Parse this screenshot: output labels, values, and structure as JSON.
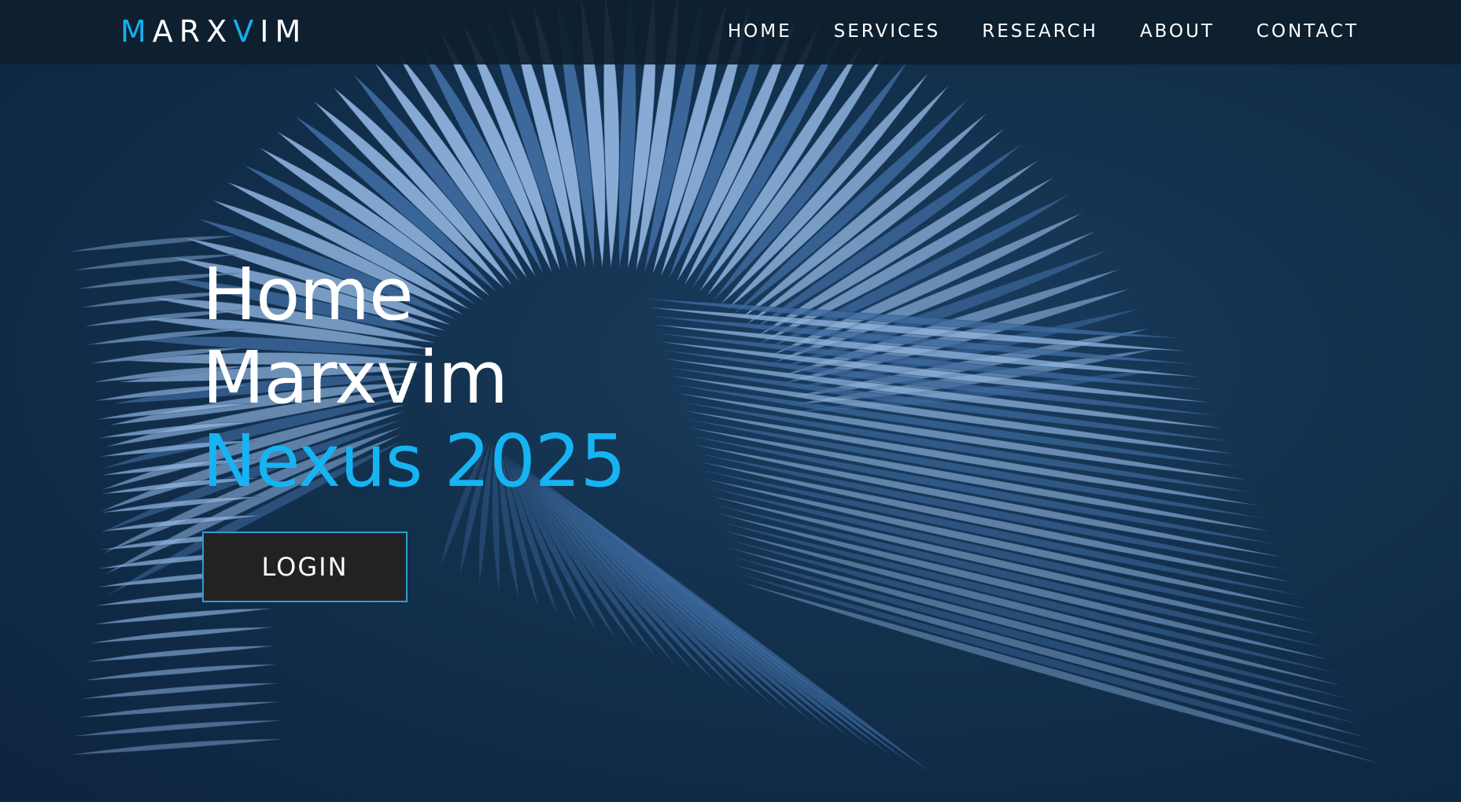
{
  "brand": {
    "logo_parts": [
      {
        "text": "M",
        "accent": true
      },
      {
        "text": "ARX",
        "accent": false
      },
      {
        "text": "V",
        "accent": true
      },
      {
        "text": "IM",
        "accent": false
      }
    ]
  },
  "nav": {
    "items": [
      {
        "label": "HOME"
      },
      {
        "label": "SERVICES"
      },
      {
        "label": "RESEARCH"
      },
      {
        "label": "ABOUT"
      },
      {
        "label": "CONTACT"
      }
    ]
  },
  "hero": {
    "line1": "Home",
    "line2": "Marxvim",
    "line3": "Nexus 2025",
    "button_label": "LOGIN"
  },
  "colors": {
    "accent": "#16b4f2",
    "nav_bg": "#0e1e2e",
    "page_bg": "#12304c",
    "button_bg": "#222222",
    "art_light": "#8fb3de",
    "art_dark": "#3f6ba0"
  },
  "icons": [
    "hero-sculpture-art"
  ]
}
